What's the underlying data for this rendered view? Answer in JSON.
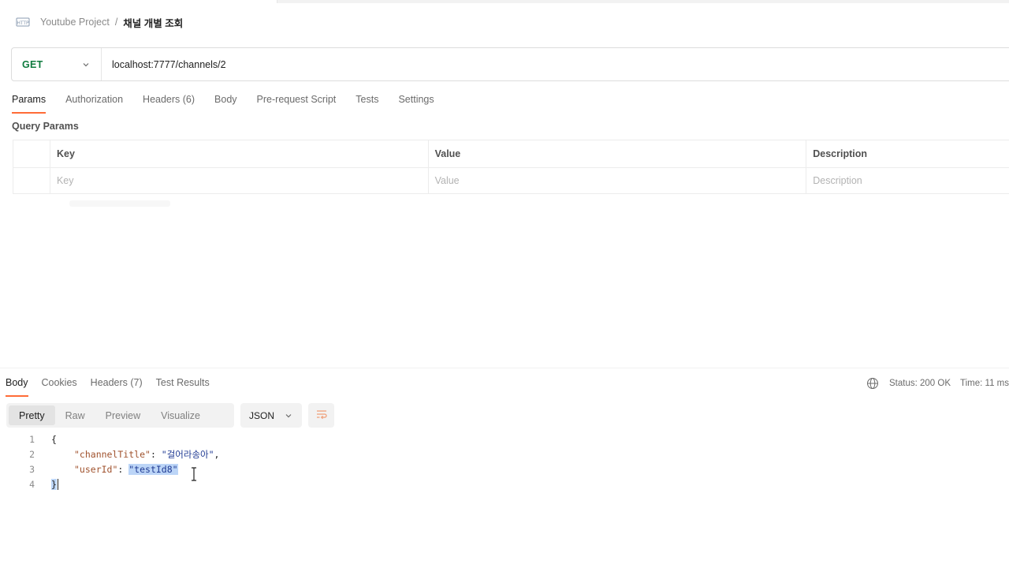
{
  "breadcrumb": {
    "project": "Youtube Project",
    "separator": "/",
    "current": "채널 개별 조회"
  },
  "request": {
    "method": "GET",
    "url": "localhost:7777/channels/2"
  },
  "request_tabs": [
    {
      "label": "Params",
      "active": true
    },
    {
      "label": "Authorization",
      "active": false
    },
    {
      "label": "Headers (6)",
      "active": false
    },
    {
      "label": "Body",
      "active": false
    },
    {
      "label": "Pre-request Script",
      "active": false
    },
    {
      "label": "Tests",
      "active": false
    },
    {
      "label": "Settings",
      "active": false
    }
  ],
  "query_params": {
    "title": "Query Params",
    "headers": {
      "key": "Key",
      "value": "Value",
      "description": "Description"
    },
    "placeholders": {
      "key": "Key",
      "value": "Value",
      "description": "Description"
    }
  },
  "response_tabs": [
    {
      "label": "Body",
      "active": true
    },
    {
      "label": "Cookies",
      "active": false
    },
    {
      "label": "Headers (7)",
      "active": false
    },
    {
      "label": "Test Results",
      "active": false
    }
  ],
  "response_status": {
    "status": "Status: 200 OK",
    "time": "Time: 11 ms"
  },
  "format_tabs": [
    {
      "label": "Pretty",
      "active": true
    },
    {
      "label": "Raw",
      "active": false
    },
    {
      "label": "Preview",
      "active": false
    },
    {
      "label": "Visualize",
      "active": false
    }
  ],
  "language": "JSON",
  "code": {
    "line_numbers": [
      "1",
      "2",
      "3",
      "4"
    ],
    "open_brace": "{",
    "close_brace": "}",
    "key1": "\"channelTitle\"",
    "value1": "\"걸어라송아\"",
    "key2": "\"userId\"",
    "value2": "\"testId8\"",
    "colon": ": ",
    "comma": ","
  },
  "colors": {
    "accent": "#ff6c37",
    "method_get": "#0f7b3e",
    "selection": "#bcd5f7"
  },
  "icons": {
    "breadcrumb": "http-icon",
    "method_dropdown": "chevron-down-icon",
    "status": "globe-icon",
    "language_dropdown": "chevron-down-icon",
    "wrap": "wrap-lines-icon"
  }
}
